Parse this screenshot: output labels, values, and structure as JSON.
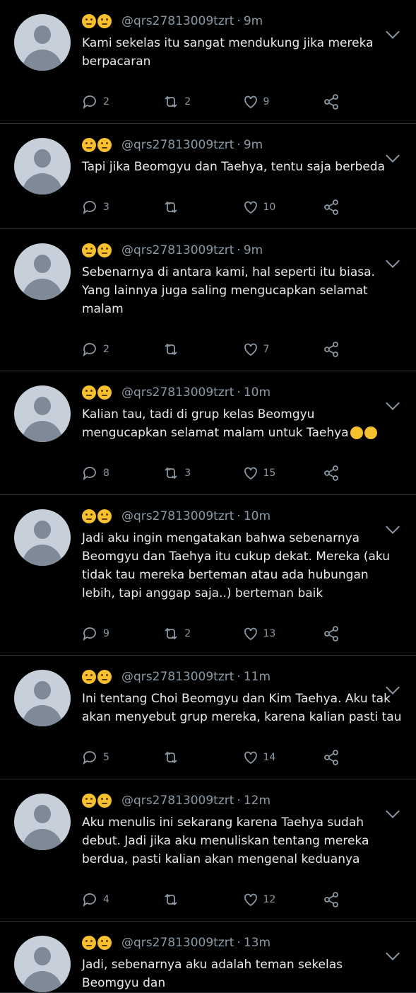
{
  "tweets": [
    {
      "emoji": [
        "thinking-face",
        "thinking-face"
      ],
      "handle": "@qrs27813009tzrt",
      "time": "9m",
      "text": "Kami sekelas itu sangat mendukung jika mereka berpacaran",
      "replies": "2",
      "retweets": "2",
      "likes": "9"
    },
    {
      "emoji": [
        "thinking-face",
        "thinking-face"
      ],
      "handle": "@qrs27813009tzrt",
      "time": "9m",
      "text": "Tapi jika Beomgyu dan Taehya, tentu saja berbeda",
      "replies": "3",
      "retweets": "",
      "likes": "10"
    },
    {
      "emoji": [
        "thinking-face",
        "thinking-face"
      ],
      "handle": "@qrs27813009tzrt",
      "time": "9m",
      "text": "Sebenarnya di antara kami, hal seperti itu biasa. Yang lainnya juga saling mengucapkan selamat malam",
      "replies": "2",
      "retweets": "",
      "likes": "7"
    },
    {
      "emoji": [
        "thinking-face",
        "thinking-face"
      ],
      "handle": "@qrs27813009tzrt",
      "time": "10m",
      "text": "Kalian tau, tadi di grup kelas Beomgyu mengucapkan selamat malam untuk Taehya",
      "text_emoji": [
        "face-with-tears-of-joy",
        "face-with-tears-of-joy"
      ],
      "replies": "8",
      "retweets": "3",
      "likes": "15"
    },
    {
      "emoji": [
        "thinking-face",
        "thinking-face"
      ],
      "handle": "@qrs27813009tzrt",
      "time": "10m",
      "text": "Jadi aku ingin mengatakan bahwa sebenarnya Beomgyu dan Taehya itu cukup dekat. Mereka (aku tidak tau mereka berteman atau ada hubungan lebih, tapi anggap saja..) berteman baik",
      "replies": "9",
      "retweets": "2",
      "likes": "13"
    },
    {
      "emoji": [
        "thinking-face",
        "thinking-face"
      ],
      "handle": "@qrs27813009tzrt",
      "time": "11m",
      "text": "Ini tentang Choi Beomgyu dan Kim Taehya. Aku tak akan menyebut grup mereka, karena kalian pasti tau",
      "replies": "5",
      "retweets": "",
      "likes": "14"
    },
    {
      "emoji": [
        "thinking-face",
        "thinking-face"
      ],
      "handle": "@qrs27813009tzrt",
      "time": "12m",
      "text": "Aku menulis ini sekarang karena Taehya sudah debut. Jadi jika aku menuliskan tentang mereka berdua, pasti kalian akan mengenal keduanya",
      "replies": "4",
      "retweets": "",
      "likes": "12"
    },
    {
      "emoji": [
        "thinking-face",
        "thinking-face"
      ],
      "handle": "@qrs27813009tzrt",
      "time": "13m",
      "text": "Jadi, sebenarnya aku adalah teman sekelas Beomgyu dan",
      "replies": "",
      "retweets": "",
      "likes": ""
    }
  ],
  "colors": {
    "background": "#000000",
    "divider": "#2f3336",
    "muted": "#8b98a5",
    "text": "#e7e9ea"
  },
  "icons": [
    "reply-icon",
    "retweet-icon",
    "like-icon",
    "share-icon",
    "chevron-down-icon"
  ]
}
